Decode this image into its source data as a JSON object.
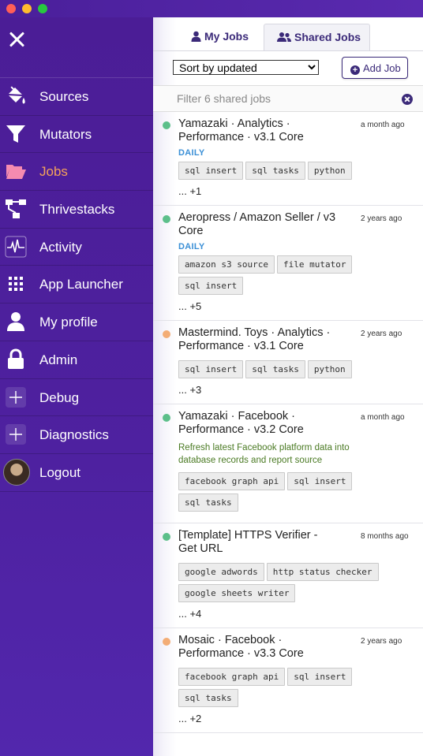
{
  "window": {
    "controls": [
      "close",
      "minimize",
      "zoom"
    ]
  },
  "sidebar": {
    "close_icon": "close-icon",
    "items": [
      {
        "label": "Sources",
        "icon": "paint-bucket-icon",
        "active": false
      },
      {
        "label": "Mutators",
        "icon": "funnel-icon",
        "active": false
      },
      {
        "label": "Jobs",
        "icon": "folder-open-icon",
        "active": true
      },
      {
        "label": "Thrivestacks",
        "icon": "flow-icon",
        "active": false
      },
      {
        "label": "Activity",
        "icon": "pulse-icon",
        "active": false
      },
      {
        "label": "App Launcher",
        "icon": "grid-icon",
        "active": false
      },
      {
        "label": "My profile",
        "icon": "user-icon",
        "active": false
      },
      {
        "label": "Admin",
        "icon": "lock-icon",
        "active": false
      },
      {
        "label": "Debug",
        "icon": "plus-box-icon",
        "active": false
      },
      {
        "label": "Diagnostics",
        "icon": "plus-box-icon",
        "active": false
      },
      {
        "label": "Logout",
        "icon": "avatar",
        "active": false
      }
    ],
    "colors": {
      "background": "#4b1d96",
      "active_label": "#f5a35a"
    }
  },
  "tabs": [
    {
      "label": "My Jobs",
      "icon": "user-icon",
      "active": false
    },
    {
      "label": "Shared Jobs",
      "icon": "users-icon",
      "active": true
    }
  ],
  "toolbar": {
    "sort_value": "Sort by updated",
    "add_job_label": "Add Job"
  },
  "filter": {
    "placeholder": "Filter 6 shared jobs"
  },
  "jobs": [
    {
      "title": "Yamazaki · Analytics · Performance · v3.1 Core",
      "status": "green",
      "time": "a month ago",
      "schedule": "DAILY",
      "description": "",
      "tags": [
        "sql insert",
        "sql tasks",
        "python"
      ],
      "more": "... +1"
    },
    {
      "title": "Aeropress / Amazon Seller / v3 Core",
      "status": "green",
      "time": "2 years ago",
      "schedule": "DAILY",
      "description": "",
      "tags": [
        "amazon s3 source",
        "file mutator",
        "sql insert"
      ],
      "more": "... +5"
    },
    {
      "title": "Mastermind. Toys · Analytics · Performance · v3.1 Core",
      "status": "orange",
      "time": "2 years ago",
      "schedule": "",
      "description": "",
      "tags": [
        "sql insert",
        "sql tasks",
        "python"
      ],
      "more": "... +3"
    },
    {
      "title": "Yamazaki · Facebook · Performance · v3.2 Core",
      "status": "green",
      "time": "a month ago",
      "schedule": "",
      "description": "Refresh latest Facebook platform data into database records and report source",
      "tags": [
        "facebook graph api",
        "sql insert",
        "sql tasks"
      ],
      "more": ""
    },
    {
      "title": "[Template] HTTPS Verifier - Get URL",
      "status": "green",
      "time": "8 months ago",
      "schedule": "",
      "description": "",
      "tags": [
        "google adwords",
        "http status checker",
        "google sheets writer"
      ],
      "more": "... +4"
    },
    {
      "title": "Mosaic · Facebook · Performance · v3.3 Core",
      "status": "orange",
      "time": "2 years ago",
      "schedule": "",
      "description": "",
      "tags": [
        "facebook graph api",
        "sql insert",
        "sql tasks"
      ],
      "more": "... +2"
    }
  ],
  "colors": {
    "accent": "#3b2a79",
    "green_status": "#5cbf8a",
    "orange_status": "#f3ad76",
    "schedule": "#3a8fd6",
    "description": "#4a7a23"
  }
}
